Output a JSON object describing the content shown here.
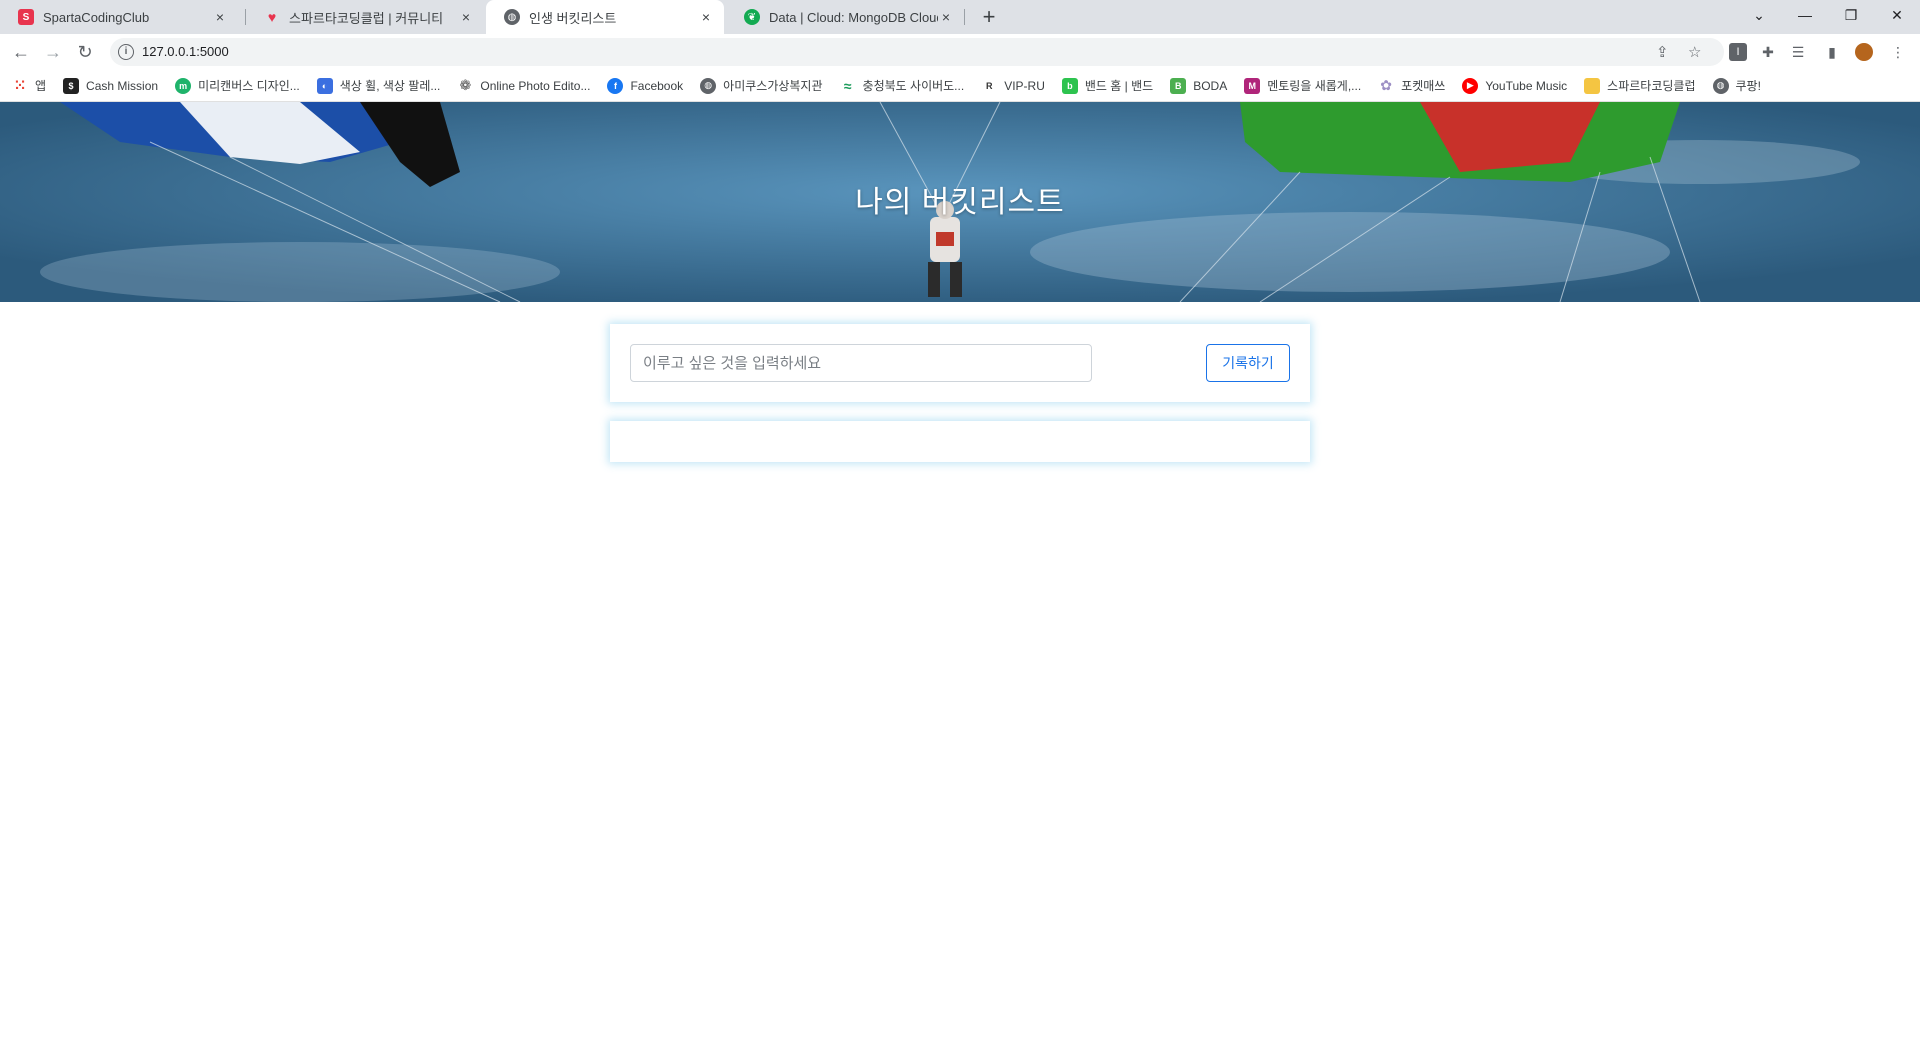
{
  "browser": {
    "tabs": [
      {
        "title": "SpartaCodingClub",
        "favicon": "sparta-icon",
        "color": "#e8344e",
        "active": false
      },
      {
        "title": "스파르타코딩클럽 | 커뮤니티",
        "favicon": "heart-chat-icon",
        "color": "#e8344e",
        "active": false
      },
      {
        "title": "인생 버킷리스트",
        "favicon": "globe-icon",
        "color": "#5f6368",
        "active": true
      },
      {
        "title": "Data | Cloud: MongoDB Cloud",
        "favicon": "mongodb-leaf-icon",
        "color": "#13aa52",
        "active": false
      }
    ],
    "close_glyph": "×",
    "new_tab_glyph": "+",
    "url": "127.0.0.1:5000"
  },
  "bookmarks": [
    {
      "label": "앱",
      "icon": "apps-grid-icon",
      "color": "#ea4335"
    },
    {
      "label": "Cash Mission",
      "icon": "cash-mission-icon",
      "color": "#222222"
    },
    {
      "label": "미리캔버스 디자인...",
      "icon": "miricanvas-icon",
      "color": "#1fb36b"
    },
    {
      "label": "색상 휠, 색상 팔레...",
      "icon": "adobe-color-icon",
      "color": "#3b6fe0"
    },
    {
      "label": "Online Photo Edito...",
      "icon": "photo-editor-icon",
      "color": "#555555"
    },
    {
      "label": "Facebook",
      "icon": "facebook-icon",
      "color": "#1877f2"
    },
    {
      "label": "아미쿠스가상복지관",
      "icon": "globe-icon",
      "color": "#5f6368"
    },
    {
      "label": "충청북도 사이버도...",
      "icon": "chungbuk-icon",
      "color": "#1a9b5a"
    },
    {
      "label": "VIP-RU",
      "icon": "vip-ru-icon",
      "color": "#333333"
    },
    {
      "label": "밴드 홈 | 밴드",
      "icon": "band-icon",
      "color": "#2dc34f"
    },
    {
      "label": "BODA",
      "icon": "boda-icon",
      "color": "#4caf50"
    },
    {
      "label": "멘토링을 새롭게,...",
      "icon": "mentoring-icon",
      "color": "#b0257a"
    },
    {
      "label": "포켓매쓰",
      "icon": "pocketmath-icon",
      "color": "#9c8fc4"
    },
    {
      "label": "YouTube Music",
      "icon": "youtube-music-icon",
      "color": "#ff0000"
    },
    {
      "label": "스파르타코딩클럽",
      "icon": "folder-icon",
      "color": "#f4c542"
    },
    {
      "label": "쿠팡!",
      "icon": "globe-icon",
      "color": "#5f6368"
    }
  ],
  "page": {
    "title": "나의 버킷리스트",
    "input_placeholder": "이루고 싶은 것을 입력하세요",
    "input_value": "",
    "save_label": "기록하기",
    "accent_color": "#1a73e8"
  }
}
